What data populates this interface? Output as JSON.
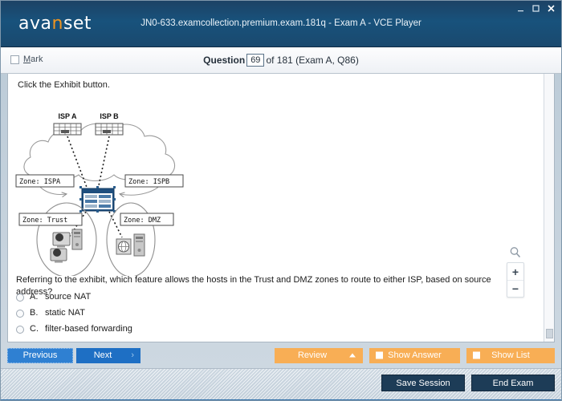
{
  "window": {
    "logo_text_a": "ava",
    "logo_text_accent": "n",
    "logo_text_b": "set",
    "title": "JN0-633.examcollection.premium.exam.181q - Exam A - VCE Player",
    "minimize_icon": "minimize-icon",
    "maximize_icon": "maximize-icon",
    "close_icon": "close-icon",
    "accent_color": "#f0941f",
    "titlebar_color": "#18527c"
  },
  "toolbar": {
    "mark_label": "Mark",
    "mark_accel": "M",
    "mark_rest": "ark",
    "mark_checked": false,
    "question_word": "Question",
    "question_number": "69",
    "question_of": "of 181 (Exam A, Q86)"
  },
  "content": {
    "exhibit_instruction": "Click the Exhibit button.",
    "question_text": "Referring to the exhibit, which feature allows the hosts in the Trust and DMZ zones to route to either ISP, based on source address?",
    "answers": [
      {
        "letter": "A.",
        "text": "source NAT",
        "selected": false
      },
      {
        "letter": "B.",
        "text": "static NAT",
        "selected": false
      },
      {
        "letter": "C.",
        "text": "filter-based forwarding",
        "selected": false
      }
    ]
  },
  "diagram": {
    "isp_a_label": "ISP A",
    "isp_b_label": "ISP B",
    "zone_ispa": "Zone: ISPA",
    "zone_ispb": "Zone: ISPB",
    "zone_trust": "Zone: Trust",
    "zone_dmz": "Zone: DMZ",
    "device_firewall": "firewall-device-icon",
    "device_switch_a": "switch-icon",
    "device_switch_b": "switch-icon",
    "host_workstation": "workstation-icon",
    "host_server": "server-icon"
  },
  "zoom_controls": {
    "magnifier_icon": "magnifier-icon",
    "zoom_in_label": "+",
    "zoom_out_label": "−"
  },
  "buttons": {
    "previous": "Previous",
    "next": "Next",
    "review": "Review",
    "show_answer": "Show Answer",
    "show_list": "Show List",
    "save_session": "Save Session",
    "end_exam": "End Exam",
    "orange_color": "#f8ae55",
    "blue_color": "#1e6fc4",
    "dark_color": "#1d3c57"
  }
}
